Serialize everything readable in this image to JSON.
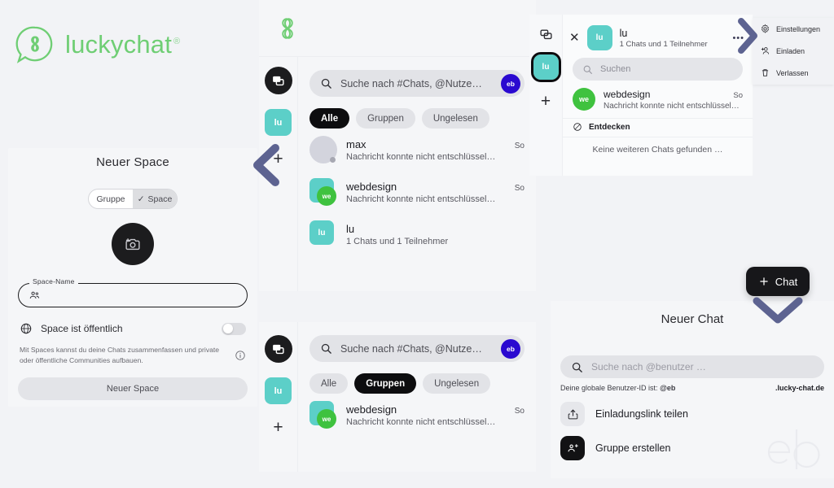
{
  "brand": {
    "name": "luckychat",
    "registered": "®"
  },
  "space_panel": {
    "title": "Neuer Space",
    "segments": [
      {
        "label": "Gruppe",
        "selected": false
      },
      {
        "label": "Space",
        "selected": true,
        "check": "✓"
      }
    ],
    "avatar_upload": "add-photo",
    "field": {
      "label": "Space-Name",
      "value": "",
      "placeholder": ""
    },
    "public_toggle": {
      "label": "Space ist öffentlich",
      "on": false
    },
    "hint": "Mit Spaces kannst du deine Chats zusammenfassen und private oder öffentliche Communities aufbauen.",
    "submit": "Neuer Space"
  },
  "chat_list": {
    "search": {
      "placeholder": "Suche nach #Chats, @Nutze…",
      "avatar": "eb"
    },
    "filters": [
      {
        "label": "Alle",
        "active": true
      },
      {
        "label": "Gruppen",
        "active": false
      },
      {
        "label": "Ungelesen",
        "active": false
      }
    ],
    "rows": [
      {
        "name": "max",
        "time": "So",
        "preview": "Nachricht konnte nicht entschlüssel…",
        "avatar_type": "circle",
        "avatar_text": ""
      },
      {
        "name": "webdesign",
        "time": "So",
        "preview": "Nachricht konnte nicht entschlüssel…",
        "avatar_type": "space-badge",
        "avatar_text": "we"
      },
      {
        "name": "lu",
        "time": "",
        "preview": "1 Chats und 1 Teilnehmer",
        "avatar_type": "square",
        "avatar_text": "lu"
      }
    ]
  },
  "chat_list_groups": {
    "search": {
      "placeholder": "Suche nach #Chats, @Nutze…",
      "avatar": "eb"
    },
    "filters": [
      {
        "label": "Alle",
        "active": false
      },
      {
        "label": "Gruppen",
        "active": true
      },
      {
        "label": "Ungelesen",
        "active": false
      }
    ],
    "rows": [
      {
        "name": "webdesign",
        "time": "So",
        "preview": "Nachricht konnte nicht entschlüssel…",
        "avatar_type": "space-badge",
        "avatar_text": "we"
      }
    ]
  },
  "space_detail": {
    "rail_avatar": "lu",
    "close": "✕",
    "avatar": "lu",
    "name": "lu",
    "meta": "1 Chats und 1 Teilnehmer",
    "more": "•••",
    "search_placeholder": "Suchen",
    "row": {
      "avatar": "we",
      "name": "webdesign",
      "time": "So",
      "preview": "Nachricht konnte nicht entschlüssel…"
    },
    "discover_label": "Entdecken",
    "empty": "Keine weiteren Chats gefunden …"
  },
  "context_menu": {
    "items": [
      {
        "label": "Einstellungen",
        "icon": "gear-icon"
      },
      {
        "label": "Einladen",
        "icon": "person-add-icon"
      },
      {
        "label": "Verlassen",
        "icon": "trash-icon"
      }
    ]
  },
  "new_chat": {
    "title": "Neuer Chat",
    "search_placeholder": "Suche nach @benutzer …",
    "user_id_prefix": "Deine globale Benutzer-ID ist: ",
    "user_id": "@eb",
    "domain": ".lucky-chat.de",
    "actions": [
      {
        "label": "Einladungslink teilen",
        "icon": "share-icon"
      },
      {
        "label": "Gruppe erstellen",
        "icon": "group-add-icon"
      }
    ],
    "watermark": "eb"
  },
  "fab": {
    "label": "Chat",
    "plus": "+"
  },
  "colors": {
    "brand_green": "#6fce74",
    "teal": "#5ccfc8",
    "green_badge": "#3fc23f",
    "purple_avatar": "#2a09d0",
    "dark": "#17171a",
    "arrow_blue": "#5d6391",
    "page_bg": "#f2f3f6"
  }
}
